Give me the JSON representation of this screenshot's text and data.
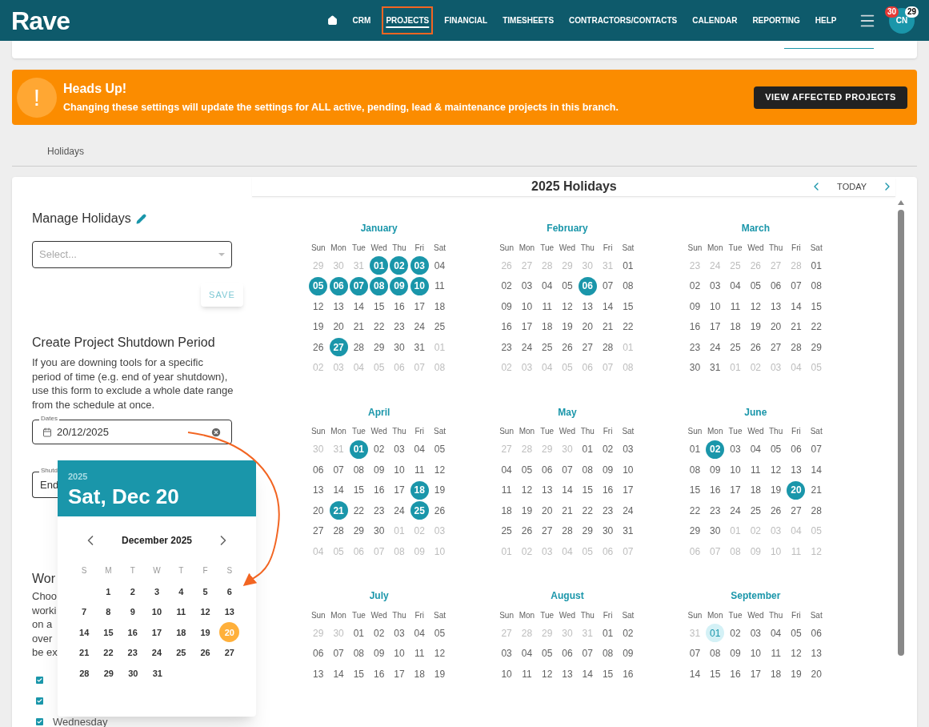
{
  "header": {
    "logo": "Rave",
    "nav": [
      {
        "label": "CRM",
        "selected": false
      },
      {
        "label": "PROJECTS",
        "selected": true
      },
      {
        "label": "FINANCIAL",
        "selected": false
      },
      {
        "label": "TIMESHEETS",
        "selected": false
      },
      {
        "label": "CONTRACTORS/CONTACTS",
        "selected": false
      },
      {
        "label": "CALENDAR",
        "selected": false
      },
      {
        "label": "REPORTING",
        "selected": false
      },
      {
        "label": "HELP",
        "selected": false
      }
    ],
    "avatar": "CN",
    "badges": [
      {
        "text": "30",
        "color": "#e53935"
      },
      {
        "text": "29",
        "color": "#ffffff"
      }
    ]
  },
  "banner": {
    "icon": "!",
    "title": "Heads Up!",
    "message": "Changing these settings will update the settings for ALL active, pending, lead & maintenance projects in this branch.",
    "button": "VIEW AFFECTED PROJECTS"
  },
  "tab": "Holidays",
  "left": {
    "manage_title": "Manage Holidays",
    "select_placeholder": "Select...",
    "save": "SAVE",
    "shutdown_title": "Create Project Shutdown Period",
    "shutdown_text": "If you are downing tools for a specific period of time (e.g. end of year shutdown), use this form to exclude a whole date range from the schedule at once.",
    "dates_label": "Dates",
    "dates_value": "20/12/2025",
    "shutdown_field_label": "Shutd",
    "shutdown_field_value": "End",
    "working_title": "Wor",
    "working_lines": [
      "Choo",
      "worki",
      "on a",
      "over",
      "be ex"
    ],
    "days": [
      {
        "checked": true
      },
      {
        "checked": true
      },
      {
        "label": "Wednesday",
        "checked": true
      }
    ]
  },
  "datepicker": {
    "year": "2025",
    "date": "Sat, Dec 20",
    "month": "December 2025",
    "weekdays": [
      "S",
      "M",
      "T",
      "W",
      "T",
      "F",
      "S"
    ],
    "weeks": [
      [
        {
          "t": "1",
          "selected": false
        },
        {
          "t": "2",
          "selected": false
        },
        {
          "t": "3",
          "selected": false
        },
        {
          "t": "4",
          "selected": false
        },
        {
          "t": "5",
          "selected": false
        },
        {
          "t": "6",
          "selected": false
        }
      ],
      [
        {
          "t": "7",
          "selected": false
        },
        {
          "t": "8",
          "selected": false
        },
        {
          "t": "9",
          "selected": false
        },
        {
          "t": "10",
          "selected": false
        },
        {
          "t": "11",
          "selected": false
        },
        {
          "t": "12",
          "selected": false
        },
        {
          "t": "13",
          "selected": false
        }
      ],
      [
        {
          "t": "14",
          "selected": false
        },
        {
          "t": "15",
          "selected": false
        },
        {
          "t": "16",
          "selected": false
        },
        {
          "t": "17",
          "selected": false
        },
        {
          "t": "18",
          "selected": false
        },
        {
          "t": "19",
          "selected": false
        },
        {
          "t": "20",
          "selected": true
        }
      ],
      [
        {
          "t": "21",
          "selected": false
        },
        {
          "t": "22",
          "selected": false
        },
        {
          "t": "23",
          "selected": false
        },
        {
          "t": "24",
          "selected": false
        },
        {
          "t": "25",
          "selected": false
        },
        {
          "t": "26",
          "selected": false
        },
        {
          "t": "27",
          "selected": false
        }
      ],
      [
        {
          "t": "28",
          "selected": false
        },
        {
          "t": "29",
          "selected": false
        },
        {
          "t": "30",
          "selected": false
        },
        {
          "t": "31",
          "selected": false
        }
      ]
    ]
  },
  "calendar": {
    "title": "2025 Holidays",
    "today": "TODAY",
    "months": [
      {
        "name": "January",
        "weekdays": [
          "Sun",
          "Mon",
          "Tue",
          "Wed",
          "Thu",
          "Fri",
          "Sat"
        ],
        "weeks": [
          [
            {
              "t": "29",
              "kind": "out"
            },
            {
              "t": "30",
              "kind": "out"
            },
            {
              "t": "31",
              "kind": "out"
            },
            {
              "t": "01",
              "kind": "holiday"
            },
            {
              "t": "02",
              "kind": "holiday"
            },
            {
              "t": "03",
              "kind": "holiday"
            },
            {
              "t": "04",
              "kind": "in"
            }
          ],
          [
            {
              "t": "05",
              "kind": "holiday"
            },
            {
              "t": "06",
              "kind": "holiday"
            },
            {
              "t": "07",
              "kind": "holiday"
            },
            {
              "t": "08",
              "kind": "holiday"
            },
            {
              "t": "09",
              "kind": "holiday"
            },
            {
              "t": "10",
              "kind": "holiday"
            },
            {
              "t": "11",
              "kind": "in"
            }
          ],
          [
            {
              "t": "12",
              "kind": "in"
            },
            {
              "t": "13",
              "kind": "in"
            },
            {
              "t": "14",
              "kind": "in"
            },
            {
              "t": "15",
              "kind": "in"
            },
            {
              "t": "16",
              "kind": "in"
            },
            {
              "t": "17",
              "kind": "in"
            },
            {
              "t": "18",
              "kind": "in"
            }
          ],
          [
            {
              "t": "19",
              "kind": "in"
            },
            {
              "t": "20",
              "kind": "in"
            },
            {
              "t": "21",
              "kind": "in"
            },
            {
              "t": "22",
              "kind": "in"
            },
            {
              "t": "23",
              "kind": "in"
            },
            {
              "t": "24",
              "kind": "in"
            },
            {
              "t": "25",
              "kind": "in"
            }
          ],
          [
            {
              "t": "26",
              "kind": "in"
            },
            {
              "t": "27",
              "kind": "holiday"
            },
            {
              "t": "28",
              "kind": "in"
            },
            {
              "t": "29",
              "kind": "in"
            },
            {
              "t": "30",
              "kind": "in"
            },
            {
              "t": "31",
              "kind": "in"
            },
            {
              "t": "01",
              "kind": "out"
            }
          ],
          [
            {
              "t": "02",
              "kind": "out"
            },
            {
              "t": "03",
              "kind": "out"
            },
            {
              "t": "04",
              "kind": "out"
            },
            {
              "t": "05",
              "kind": "out"
            },
            {
              "t": "06",
              "kind": "out"
            },
            {
              "t": "07",
              "kind": "out"
            },
            {
              "t": "08",
              "kind": "out"
            }
          ]
        ]
      },
      {
        "name": "February",
        "weekdays": [
          "Sun",
          "Mon",
          "Tue",
          "Wed",
          "Thu",
          "Fri",
          "Sat"
        ],
        "weeks": [
          [
            {
              "t": "26",
              "kind": "out"
            },
            {
              "t": "27",
              "kind": "out"
            },
            {
              "t": "28",
              "kind": "out"
            },
            {
              "t": "29",
              "kind": "out"
            },
            {
              "t": "30",
              "kind": "out"
            },
            {
              "t": "31",
              "kind": "out"
            },
            {
              "t": "01",
              "kind": "in"
            }
          ],
          [
            {
              "t": "02",
              "kind": "in"
            },
            {
              "t": "03",
              "kind": "in"
            },
            {
              "t": "04",
              "kind": "in"
            },
            {
              "t": "05",
              "kind": "in"
            },
            {
              "t": "06",
              "kind": "holiday"
            },
            {
              "t": "07",
              "kind": "in"
            },
            {
              "t": "08",
              "kind": "in"
            }
          ],
          [
            {
              "t": "09",
              "kind": "in"
            },
            {
              "t": "10",
              "kind": "in"
            },
            {
              "t": "11",
              "kind": "in"
            },
            {
              "t": "12",
              "kind": "in"
            },
            {
              "t": "13",
              "kind": "in"
            },
            {
              "t": "14",
              "kind": "in"
            },
            {
              "t": "15",
              "kind": "in"
            }
          ],
          [
            {
              "t": "16",
              "kind": "in"
            },
            {
              "t": "17",
              "kind": "in"
            },
            {
              "t": "18",
              "kind": "in"
            },
            {
              "t": "19",
              "kind": "in"
            },
            {
              "t": "20",
              "kind": "in"
            },
            {
              "t": "21",
              "kind": "in"
            },
            {
              "t": "22",
              "kind": "in"
            }
          ],
          [
            {
              "t": "23",
              "kind": "in"
            },
            {
              "t": "24",
              "kind": "in"
            },
            {
              "t": "25",
              "kind": "in"
            },
            {
              "t": "26",
              "kind": "in"
            },
            {
              "t": "27",
              "kind": "in"
            },
            {
              "t": "28",
              "kind": "in"
            },
            {
              "t": "01",
              "kind": "out"
            }
          ],
          [
            {
              "t": "02",
              "kind": "out"
            },
            {
              "t": "03",
              "kind": "out"
            },
            {
              "t": "04",
              "kind": "out"
            },
            {
              "t": "05",
              "kind": "out"
            },
            {
              "t": "06",
              "kind": "out"
            },
            {
              "t": "07",
              "kind": "out"
            },
            {
              "t": "08",
              "kind": "out"
            }
          ]
        ]
      },
      {
        "name": "March",
        "weekdays": [
          "Sun",
          "Mon",
          "Tue",
          "Wed",
          "Thu",
          "Fri",
          "Sat"
        ],
        "weeks": [
          [
            {
              "t": "23",
              "kind": "out"
            },
            {
              "t": "24",
              "kind": "out"
            },
            {
              "t": "25",
              "kind": "out"
            },
            {
              "t": "26",
              "kind": "out"
            },
            {
              "t": "27",
              "kind": "out"
            },
            {
              "t": "28",
              "kind": "out"
            },
            {
              "t": "01",
              "kind": "in"
            }
          ],
          [
            {
              "t": "02",
              "kind": "in"
            },
            {
              "t": "03",
              "kind": "in"
            },
            {
              "t": "04",
              "kind": "in"
            },
            {
              "t": "05",
              "kind": "in"
            },
            {
              "t": "06",
              "kind": "in"
            },
            {
              "t": "07",
              "kind": "in"
            },
            {
              "t": "08",
              "kind": "in"
            }
          ],
          [
            {
              "t": "09",
              "kind": "in"
            },
            {
              "t": "10",
              "kind": "in"
            },
            {
              "t": "11",
              "kind": "in"
            },
            {
              "t": "12",
              "kind": "in"
            },
            {
              "t": "13",
              "kind": "in"
            },
            {
              "t": "14",
              "kind": "in"
            },
            {
              "t": "15",
              "kind": "in"
            }
          ],
          [
            {
              "t": "16",
              "kind": "in"
            },
            {
              "t": "17",
              "kind": "in"
            },
            {
              "t": "18",
              "kind": "in"
            },
            {
              "t": "19",
              "kind": "in"
            },
            {
              "t": "20",
              "kind": "in"
            },
            {
              "t": "21",
              "kind": "in"
            },
            {
              "t": "22",
              "kind": "in"
            }
          ],
          [
            {
              "t": "23",
              "kind": "in"
            },
            {
              "t": "24",
              "kind": "in"
            },
            {
              "t": "25",
              "kind": "in"
            },
            {
              "t": "26",
              "kind": "in"
            },
            {
              "t": "27",
              "kind": "in"
            },
            {
              "t": "28",
              "kind": "in"
            },
            {
              "t": "29",
              "kind": "in"
            }
          ],
          [
            {
              "t": "30",
              "kind": "in"
            },
            {
              "t": "31",
              "kind": "in"
            },
            {
              "t": "01",
              "kind": "out"
            },
            {
              "t": "02",
              "kind": "out"
            },
            {
              "t": "03",
              "kind": "out"
            },
            {
              "t": "04",
              "kind": "out"
            },
            {
              "t": "05",
              "kind": "out"
            }
          ]
        ]
      },
      {
        "name": "April",
        "weekdays": [
          "Sun",
          "Mon",
          "Tue",
          "Wed",
          "Thu",
          "Fri",
          "Sat"
        ],
        "weeks": [
          [
            {
              "t": "30",
              "kind": "out"
            },
            {
              "t": "31",
              "kind": "out"
            },
            {
              "t": "01",
              "kind": "holiday"
            },
            {
              "t": "02",
              "kind": "in"
            },
            {
              "t": "03",
              "kind": "in"
            },
            {
              "t": "04",
              "kind": "in"
            },
            {
              "t": "05",
              "kind": "in"
            }
          ],
          [
            {
              "t": "06",
              "kind": "in"
            },
            {
              "t": "07",
              "kind": "in"
            },
            {
              "t": "08",
              "kind": "in"
            },
            {
              "t": "09",
              "kind": "in"
            },
            {
              "t": "10",
              "kind": "in"
            },
            {
              "t": "11",
              "kind": "in"
            },
            {
              "t": "12",
              "kind": "in"
            }
          ],
          [
            {
              "t": "13",
              "kind": "in"
            },
            {
              "t": "14",
              "kind": "in"
            },
            {
              "t": "15",
              "kind": "in"
            },
            {
              "t": "16",
              "kind": "in"
            },
            {
              "t": "17",
              "kind": "in"
            },
            {
              "t": "18",
              "kind": "holiday"
            },
            {
              "t": "19",
              "kind": "in"
            }
          ],
          [
            {
              "t": "20",
              "kind": "in"
            },
            {
              "t": "21",
              "kind": "holiday"
            },
            {
              "t": "22",
              "kind": "in"
            },
            {
              "t": "23",
              "kind": "in"
            },
            {
              "t": "24",
              "kind": "in"
            },
            {
              "t": "25",
              "kind": "holiday"
            },
            {
              "t": "26",
              "kind": "in"
            }
          ],
          [
            {
              "t": "27",
              "kind": "in"
            },
            {
              "t": "28",
              "kind": "in"
            },
            {
              "t": "29",
              "kind": "in"
            },
            {
              "t": "30",
              "kind": "in"
            },
            {
              "t": "01",
              "kind": "out"
            },
            {
              "t": "02",
              "kind": "out"
            },
            {
              "t": "03",
              "kind": "out"
            }
          ],
          [
            {
              "t": "04",
              "kind": "out"
            },
            {
              "t": "05",
              "kind": "out"
            },
            {
              "t": "06",
              "kind": "out"
            },
            {
              "t": "07",
              "kind": "out"
            },
            {
              "t": "08",
              "kind": "out"
            },
            {
              "t": "09",
              "kind": "out"
            },
            {
              "t": "10",
              "kind": "out"
            }
          ]
        ]
      },
      {
        "name": "May",
        "weekdays": [
          "Sun",
          "Mon",
          "Tue",
          "Wed",
          "Thu",
          "Fri",
          "Sat"
        ],
        "weeks": [
          [
            {
              "t": "27",
              "kind": "out"
            },
            {
              "t": "28",
              "kind": "out"
            },
            {
              "t": "29",
              "kind": "out"
            },
            {
              "t": "30",
              "kind": "out"
            },
            {
              "t": "01",
              "kind": "in"
            },
            {
              "t": "02",
              "kind": "in"
            },
            {
              "t": "03",
              "kind": "in"
            }
          ],
          [
            {
              "t": "04",
              "kind": "in"
            },
            {
              "t": "05",
              "kind": "in"
            },
            {
              "t": "06",
              "kind": "in"
            },
            {
              "t": "07",
              "kind": "in"
            },
            {
              "t": "08",
              "kind": "in"
            },
            {
              "t": "09",
              "kind": "in"
            },
            {
              "t": "10",
              "kind": "in"
            }
          ],
          [
            {
              "t": "11",
              "kind": "in"
            },
            {
              "t": "12",
              "kind": "in"
            },
            {
              "t": "13",
              "kind": "in"
            },
            {
              "t": "14",
              "kind": "in"
            },
            {
              "t": "15",
              "kind": "in"
            },
            {
              "t": "16",
              "kind": "in"
            },
            {
              "t": "17",
              "kind": "in"
            }
          ],
          [
            {
              "t": "18",
              "kind": "in"
            },
            {
              "t": "19",
              "kind": "in"
            },
            {
              "t": "20",
              "kind": "in"
            },
            {
              "t": "21",
              "kind": "in"
            },
            {
              "t": "22",
              "kind": "in"
            },
            {
              "t": "23",
              "kind": "in"
            },
            {
              "t": "24",
              "kind": "in"
            }
          ],
          [
            {
              "t": "25",
              "kind": "in"
            },
            {
              "t": "26",
              "kind": "in"
            },
            {
              "t": "27",
              "kind": "in"
            },
            {
              "t": "28",
              "kind": "in"
            },
            {
              "t": "29",
              "kind": "in"
            },
            {
              "t": "30",
              "kind": "in"
            },
            {
              "t": "31",
              "kind": "in"
            }
          ],
          [
            {
              "t": "01",
              "kind": "out"
            },
            {
              "t": "02",
              "kind": "out"
            },
            {
              "t": "03",
              "kind": "out"
            },
            {
              "t": "04",
              "kind": "out"
            },
            {
              "t": "05",
              "kind": "out"
            },
            {
              "t": "06",
              "kind": "out"
            },
            {
              "t": "07",
              "kind": "out"
            }
          ]
        ]
      },
      {
        "name": "June",
        "weekdays": [
          "Sun",
          "Mon",
          "Tue",
          "Wed",
          "Thu",
          "Fri",
          "Sat"
        ],
        "weeks": [
          [
            {
              "t": "01",
              "kind": "in"
            },
            {
              "t": "02",
              "kind": "holiday"
            },
            {
              "t": "03",
              "kind": "in"
            },
            {
              "t": "04",
              "kind": "in"
            },
            {
              "t": "05",
              "kind": "in"
            },
            {
              "t": "06",
              "kind": "in"
            },
            {
              "t": "07",
              "kind": "in"
            }
          ],
          [
            {
              "t": "08",
              "kind": "in"
            },
            {
              "t": "09",
              "kind": "in"
            },
            {
              "t": "10",
              "kind": "in"
            },
            {
              "t": "11",
              "kind": "in"
            },
            {
              "t": "12",
              "kind": "in"
            },
            {
              "t": "13",
              "kind": "in"
            },
            {
              "t": "14",
              "kind": "in"
            }
          ],
          [
            {
              "t": "15",
              "kind": "in"
            },
            {
              "t": "16",
              "kind": "in"
            },
            {
              "t": "17",
              "kind": "in"
            },
            {
              "t": "18",
              "kind": "in"
            },
            {
              "t": "19",
              "kind": "in"
            },
            {
              "t": "20",
              "kind": "holiday"
            },
            {
              "t": "21",
              "kind": "in"
            }
          ],
          [
            {
              "t": "22",
              "kind": "in"
            },
            {
              "t": "23",
              "kind": "in"
            },
            {
              "t": "24",
              "kind": "in"
            },
            {
              "t": "25",
              "kind": "in"
            },
            {
              "t": "26",
              "kind": "in"
            },
            {
              "t": "27",
              "kind": "in"
            },
            {
              "t": "28",
              "kind": "in"
            }
          ],
          [
            {
              "t": "29",
              "kind": "in"
            },
            {
              "t": "30",
              "kind": "in"
            },
            {
              "t": "01",
              "kind": "out"
            },
            {
              "t": "02",
              "kind": "out"
            },
            {
              "t": "03",
              "kind": "out"
            },
            {
              "t": "04",
              "kind": "out"
            },
            {
              "t": "05",
              "kind": "out"
            }
          ],
          [
            {
              "t": "06",
              "kind": "out"
            },
            {
              "t": "07",
              "kind": "out"
            },
            {
              "t": "08",
              "kind": "out"
            },
            {
              "t": "09",
              "kind": "out"
            },
            {
              "t": "10",
              "kind": "out"
            },
            {
              "t": "11",
              "kind": "out"
            },
            {
              "t": "12",
              "kind": "out"
            }
          ]
        ]
      },
      {
        "name": "July",
        "weekdays": [
          "Sun",
          "Mon",
          "Tue",
          "Wed",
          "Thu",
          "Fri",
          "Sat"
        ],
        "weeks": [
          [
            {
              "t": "29",
              "kind": "out"
            },
            {
              "t": "30",
              "kind": "out"
            },
            {
              "t": "01",
              "kind": "in"
            },
            {
              "t": "02",
              "kind": "in"
            },
            {
              "t": "03",
              "kind": "in"
            },
            {
              "t": "04",
              "kind": "in"
            },
            {
              "t": "05",
              "kind": "in"
            }
          ],
          [
            {
              "t": "06",
              "kind": "in"
            },
            {
              "t": "07",
              "kind": "in"
            },
            {
              "t": "08",
              "kind": "in"
            },
            {
              "t": "09",
              "kind": "in"
            },
            {
              "t": "10",
              "kind": "in"
            },
            {
              "t": "11",
              "kind": "in"
            },
            {
              "t": "12",
              "kind": "in"
            }
          ],
          [
            {
              "t": "13",
              "kind": "in"
            },
            {
              "t": "14",
              "kind": "in"
            },
            {
              "t": "15",
              "kind": "in"
            },
            {
              "t": "16",
              "kind": "in"
            },
            {
              "t": "17",
              "kind": "in"
            },
            {
              "t": "18",
              "kind": "in"
            },
            {
              "t": "19",
              "kind": "in"
            }
          ]
        ]
      },
      {
        "name": "August",
        "weekdays": [
          "Sun",
          "Mon",
          "Tue",
          "Wed",
          "Thu",
          "Fri",
          "Sat"
        ],
        "weeks": [
          [
            {
              "t": "27",
              "kind": "out"
            },
            {
              "t": "28",
              "kind": "out"
            },
            {
              "t": "29",
              "kind": "out"
            },
            {
              "t": "30",
              "kind": "out"
            },
            {
              "t": "31",
              "kind": "out"
            },
            {
              "t": "01",
              "kind": "in"
            },
            {
              "t": "02",
              "kind": "in"
            }
          ],
          [
            {
              "t": "03",
              "kind": "in"
            },
            {
              "t": "04",
              "kind": "in"
            },
            {
              "t": "05",
              "kind": "in"
            },
            {
              "t": "06",
              "kind": "in"
            },
            {
              "t": "07",
              "kind": "in"
            },
            {
              "t": "08",
              "kind": "in"
            },
            {
              "t": "09",
              "kind": "in"
            }
          ],
          [
            {
              "t": "10",
              "kind": "in"
            },
            {
              "t": "11",
              "kind": "in"
            },
            {
              "t": "12",
              "kind": "in"
            },
            {
              "t": "13",
              "kind": "in"
            },
            {
              "t": "14",
              "kind": "in"
            },
            {
              "t": "15",
              "kind": "in"
            },
            {
              "t": "16",
              "kind": "in"
            }
          ]
        ]
      },
      {
        "name": "September",
        "weekdays": [
          "Sun",
          "Mon",
          "Tue",
          "Wed",
          "Thu",
          "Fri",
          "Sat"
        ],
        "weeks": [
          [
            {
              "t": "31",
              "kind": "out"
            },
            {
              "t": "01",
              "kind": "today"
            },
            {
              "t": "02",
              "kind": "in"
            },
            {
              "t": "03",
              "kind": "in"
            },
            {
              "t": "04",
              "kind": "in"
            },
            {
              "t": "05",
              "kind": "in"
            },
            {
              "t": "06",
              "kind": "in"
            }
          ],
          [
            {
              "t": "07",
              "kind": "in"
            },
            {
              "t": "08",
              "kind": "in"
            },
            {
              "t": "09",
              "kind": "in"
            },
            {
              "t": "10",
              "kind": "in"
            },
            {
              "t": "11",
              "kind": "in"
            },
            {
              "t": "12",
              "kind": "in"
            },
            {
              "t": "13",
              "kind": "in"
            }
          ],
          [
            {
              "t": "14",
              "kind": "in"
            },
            {
              "t": "15",
              "kind": "in"
            },
            {
              "t": "16",
              "kind": "in"
            },
            {
              "t": "17",
              "kind": "in"
            },
            {
              "t": "18",
              "kind": "in"
            },
            {
              "t": "19",
              "kind": "in"
            },
            {
              "t": "20",
              "kind": "in"
            }
          ]
        ]
      }
    ]
  }
}
